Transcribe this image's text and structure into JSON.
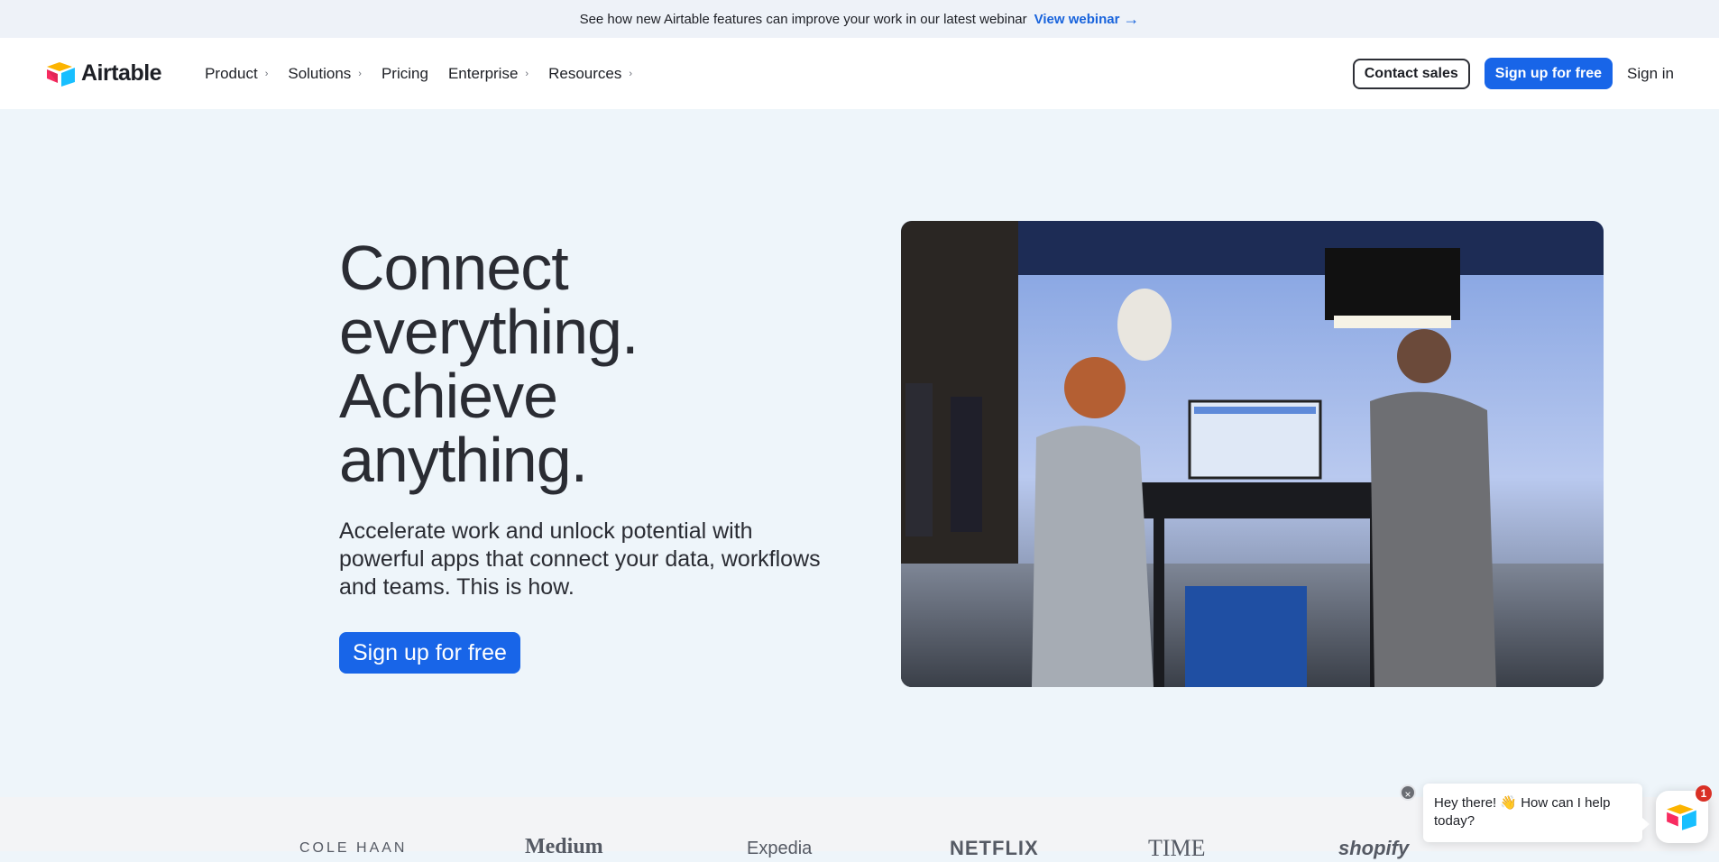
{
  "announcement": {
    "text": "See how new Airtable features can improve your work in our latest webinar",
    "link_label": "View webinar",
    "arrow": "→"
  },
  "header": {
    "logo_text": "Airtable",
    "nav": [
      {
        "label": "Product",
        "has_menu": true
      },
      {
        "label": "Solutions",
        "has_menu": true
      },
      {
        "label": "Pricing",
        "has_menu": false
      },
      {
        "label": "Enterprise",
        "has_menu": true
      },
      {
        "label": "Resources",
        "has_menu": true
      }
    ],
    "contact_sales": "Contact sales",
    "signup": "Sign up for free",
    "signin": "Sign in"
  },
  "hero": {
    "title_lines": [
      "Connect",
      "everything.",
      "Achieve",
      "anything."
    ],
    "subtitle": "Accelerate work and unlock potential with powerful apps that connect your data, workflows and teams. This is how.",
    "cta": "Sign up for free"
  },
  "logos": [
    "COLE HAAN",
    "Medium",
    "Expedia",
    "NETFLIX",
    "TIME",
    "shopify"
  ],
  "chat": {
    "message": "Hey there! 👋 How can I help today?",
    "badge_count": "1",
    "close_symbol": "×"
  },
  "colors": {
    "accent": "#1865e8",
    "link": "#1863dc",
    "page_bg": "#eef5fa",
    "text": "#1d1f25"
  }
}
